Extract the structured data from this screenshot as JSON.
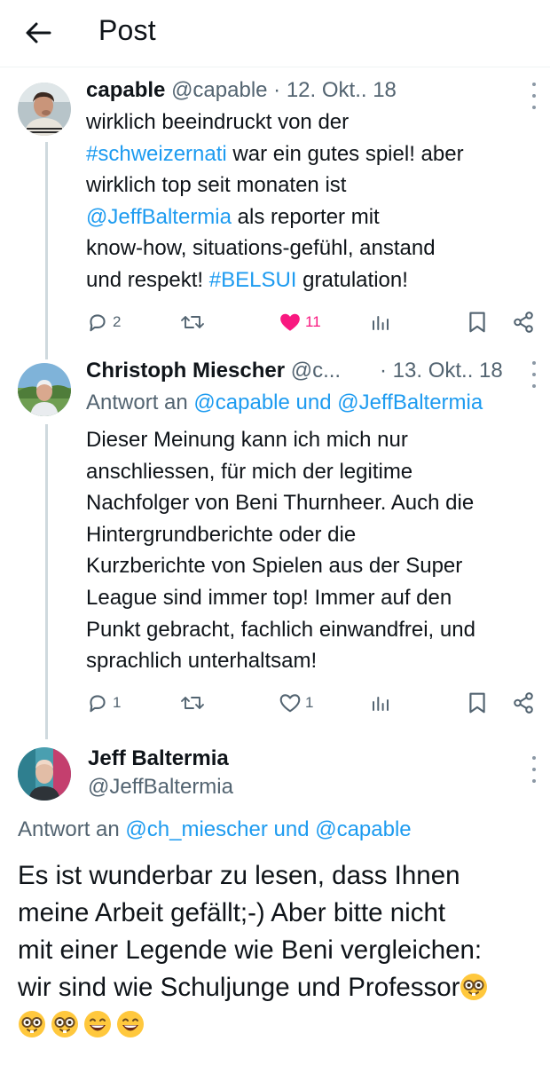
{
  "header": {
    "title": "Post"
  },
  "tweets": [
    {
      "name": "capable",
      "handle": "@capable",
      "date": "· 12. Okt.. 18",
      "lines": [
        [
          {
            "t": "wirklich beeindruckt von der",
            "link": false
          }
        ],
        [
          {
            "t": "#schweizernati",
            "link": true
          },
          {
            "t": " war ein gutes spiel! aber",
            "link": false
          }
        ],
        [
          {
            "t": "wirklich top seit monaten ist",
            "link": false
          }
        ],
        [
          {
            "t": "@JeffBaltermia",
            "link": true
          },
          {
            "t": " als reporter mit",
            "link": false
          }
        ],
        [
          {
            "t": "know-how, situations-gefühl, anstand",
            "link": false
          }
        ],
        [
          {
            "t": "und respekt! ",
            "link": false
          },
          {
            "t": "#BELSUI",
            "link": true
          },
          {
            "t": " gratulation!",
            "link": false
          }
        ]
      ],
      "actions": {
        "replies": "2",
        "reposts": "",
        "likes": "11",
        "liked": true
      }
    },
    {
      "name": "Christoph Miescher",
      "handle": "@c...",
      "date": "· 13. Okt.. 18",
      "reply_prefix": "Antwort an",
      "reply_to": "@capable und @JeffBaltermia",
      "lines": [
        [
          {
            "t": "Dieser Meinung kann ich mich nur",
            "link": false
          }
        ],
        [
          {
            "t": "anschliessen, für mich der legitime",
            "link": false
          }
        ],
        [
          {
            "t": "Nachfolger von Beni Thurnheer. Auch die",
            "link": false
          }
        ],
        [
          {
            "t": "Hintergrundberichte oder die",
            "link": false
          }
        ],
        [
          {
            "t": "Kurzberichte von Spielen aus der Super",
            "link": false
          }
        ],
        [
          {
            "t": "League sind immer top! Immer auf den",
            "link": false
          }
        ],
        [
          {
            "t": "Punkt gebracht, fachlich einwandfrei, und",
            "link": false
          }
        ],
        [
          {
            "t": "sprachlich unterhaltsam!",
            "link": false
          }
        ]
      ],
      "actions": {
        "replies": "1",
        "reposts": "",
        "likes": "1",
        "liked": false
      }
    }
  ],
  "main_tweet": {
    "name": "Jeff Baltermia",
    "handle": "@JeffBaltermia",
    "reply_prefix": "Antwort an",
    "reply_to": "@ch_miescher und @capable",
    "lines": [
      "Es ist wunderbar zu lesen, dass Ihnen",
      "meine Arbeit gefällt;-) Aber bitte nicht",
      "mit einer Legende wie Beni vergleichen:",
      "wir sind wie Schuljunge und Professor"
    ],
    "emojis": [
      "nerd-face",
      "nerd-face",
      "grinning-face",
      "grinning-face"
    ]
  },
  "colors": {
    "link": "#1d9bf0",
    "muted": "#536471",
    "like": "#f91880",
    "thread_line": "#cfd9de"
  }
}
